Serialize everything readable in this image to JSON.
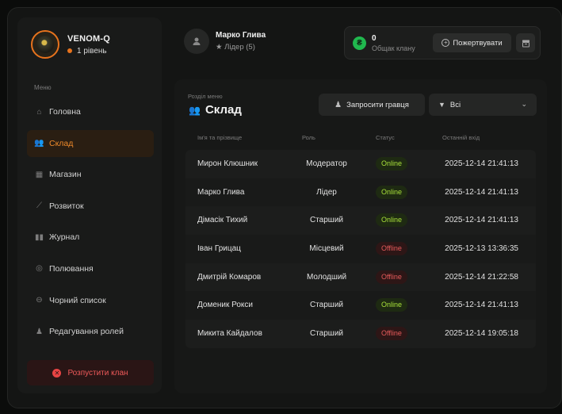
{
  "clan": {
    "name": "VENOM-Q",
    "level": "1 рівень"
  },
  "menu": {
    "title": "Меню",
    "items": [
      {
        "label": "Головна",
        "icon": "home-icon",
        "glyph": "⌂",
        "active": false
      },
      {
        "label": "Склад",
        "icon": "people-icon",
        "glyph": "👥",
        "active": true
      },
      {
        "label": "Магазин",
        "icon": "shop-icon",
        "glyph": "▦",
        "active": false
      },
      {
        "label": "Розвиток",
        "icon": "chart-icon",
        "glyph": "⟋",
        "active": false
      },
      {
        "label": "Журнал",
        "icon": "book-icon",
        "glyph": "▮▮",
        "active": false
      },
      {
        "label": "Полювання",
        "icon": "target-icon",
        "glyph": "◎",
        "active": false
      },
      {
        "label": "Чорний список",
        "icon": "block-icon",
        "glyph": "⊖",
        "active": false
      },
      {
        "label": "Редагування ролей",
        "icon": "user-edit-icon",
        "glyph": "♟",
        "active": false
      }
    ],
    "disband": "Розпустити клан"
  },
  "user": {
    "name": "Марко Глива",
    "role": "Лідер (5)"
  },
  "fund": {
    "value": "0",
    "label": "Общак клану",
    "donate": "Пожертвувати"
  },
  "section": {
    "label": "Розділ меню",
    "title": "Склад"
  },
  "invite": "Запросити гравця",
  "filter": {
    "selected": "Всі"
  },
  "table": {
    "headers": {
      "name": "Ім'я та прізвище",
      "role": "Роль",
      "status": "Статус",
      "last": "Останній вхід"
    },
    "rows": [
      {
        "name": "Мирон Клюшник",
        "role": "Модератор",
        "status": "Online",
        "last": "2025-12-14 21:41:13"
      },
      {
        "name": "Марко Глива",
        "role": "Лідер",
        "status": "Online",
        "last": "2025-12-14 21:41:13"
      },
      {
        "name": "Дімасік Тихий",
        "role": "Старший",
        "status": "Online",
        "last": "2025-12-14 21:41:13"
      },
      {
        "name": "Іван Грицац",
        "role": "Місцевий",
        "status": "Offline",
        "last": "2025-12-13 13:36:35"
      },
      {
        "name": "Дмитрій Комаров",
        "role": "Молодший",
        "status": "Offline",
        "last": "2025-12-14 21:22:58"
      },
      {
        "name": "Доменик Рокси",
        "role": "Старший",
        "status": "Online",
        "last": "2025-12-14 21:41:13"
      },
      {
        "name": "Микита Кайдалов",
        "role": "Старший",
        "status": "Offline",
        "last": "2025-12-14 19:05:18"
      }
    ]
  },
  "colors": {
    "accent": "#e7731d",
    "online": "#a9e23a",
    "offline": "#e55a5a",
    "coin": "#20b84e"
  }
}
